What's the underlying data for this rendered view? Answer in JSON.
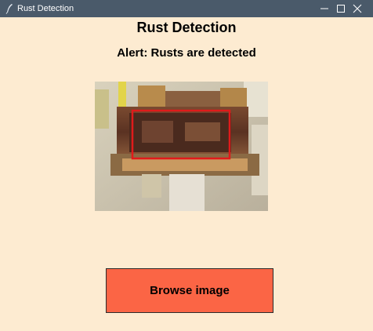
{
  "window": {
    "title": "Rust Detection",
    "icons": {
      "app": "feather-icon",
      "minimize": "minimize-icon",
      "maximize": "maximize-icon",
      "close": "close-icon"
    }
  },
  "main": {
    "heading": "Rust Detection",
    "alert": "Alert: Rusts are detected",
    "image": {
      "description_icon": "rust-photo",
      "detection_box_color": "#e01b1b"
    },
    "browse_label": "Browse image"
  },
  "colors": {
    "background": "#fdebd1",
    "titlebar": "#4a5a6a",
    "button": "#fb6545"
  }
}
